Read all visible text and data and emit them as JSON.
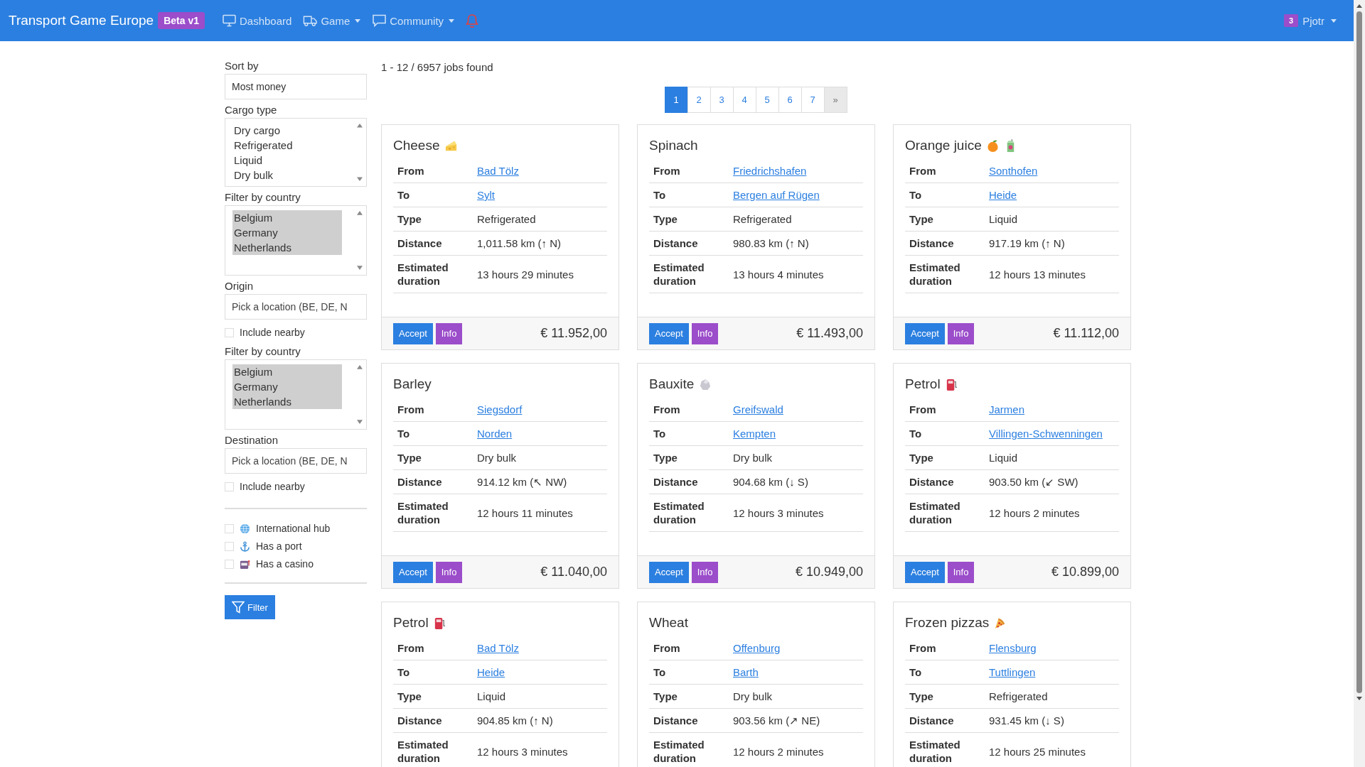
{
  "navbar": {
    "brand": "Transport Game Europe",
    "badge": "Beta v1",
    "items": [
      {
        "label": "Dashboard",
        "kind": "monitor",
        "dropdown": false
      },
      {
        "label": "Game",
        "kind": "truck",
        "dropdown": true
      },
      {
        "label": "Community",
        "kind": "chat",
        "dropdown": true
      }
    ],
    "user": {
      "count": "3",
      "name": "Pjotr"
    }
  },
  "sidebar": {
    "sort": {
      "label": "Sort by",
      "value": "Most money"
    },
    "cargo": {
      "label": "Cargo type",
      "options": [
        {
          "label": "Dry cargo",
          "selected": false
        },
        {
          "label": "Refrigerated",
          "selected": false
        },
        {
          "label": "Liquid",
          "selected": false
        },
        {
          "label": "Dry bulk",
          "selected": false
        }
      ]
    },
    "origin_countries": {
      "label": "Filter by country",
      "options": [
        {
          "label": "Belgium",
          "selected": true
        },
        {
          "label": "Germany",
          "selected": true
        },
        {
          "label": "Netherlands",
          "selected": true
        }
      ]
    },
    "origin": {
      "label": "Origin",
      "placeholder": "Pick a location (BE, DE, N",
      "include_nearby": {
        "label": "Include nearby",
        "checked": false
      }
    },
    "destination_countries": {
      "label": "Filter by country",
      "options": [
        {
          "label": "Belgium",
          "selected": true
        },
        {
          "label": "Germany",
          "selected": true
        },
        {
          "label": "Netherlands",
          "selected": true
        }
      ]
    },
    "destination": {
      "label": "Destination",
      "placeholder": "Pick a location (BE, DE, N",
      "include_nearby": {
        "label": "Include nearby",
        "checked": false
      }
    },
    "features": [
      {
        "label": "International hub",
        "kind": "globe",
        "checked": false
      },
      {
        "label": "Has a port",
        "kind": "anchor",
        "checked": false
      },
      {
        "label": "Has a casino",
        "kind": "slot",
        "checked": false
      }
    ],
    "filter_button": "Filter"
  },
  "results": {
    "summary": "1 - 12 / 6957 jobs found",
    "pages": [
      {
        "label": "1",
        "selected": true
      },
      {
        "label": "2",
        "selected": false
      },
      {
        "label": "3",
        "selected": false
      },
      {
        "label": "4",
        "selected": false
      },
      {
        "label": "5",
        "selected": false
      },
      {
        "label": "6",
        "selected": false
      },
      {
        "label": "7",
        "selected": false
      }
    ],
    "next": {
      "label": "»",
      "disabled": true
    },
    "jobs": [
      {
        "title": "Cheese",
        "icons": [
          {
            "kind": "cheese"
          }
        ],
        "rows": [
          {
            "label": "From",
            "value": "Bad Tölz",
            "kind": "link"
          },
          {
            "label": "To",
            "value": "Sylt",
            "kind": "link"
          },
          {
            "label": "Type",
            "value": "Refrigerated",
            "kind": "text"
          },
          {
            "label": "Distance",
            "value": "1,011.58 km (↑ N)",
            "kind": "text"
          },
          {
            "label": "Estimated duration",
            "value": "13 hours 29 minutes",
            "kind": "text"
          }
        ],
        "buttons": [
          "Accept",
          "Info"
        ],
        "price": "€ 11.952,00"
      },
      {
        "title": "Spinach",
        "rows": [
          {
            "label": "From",
            "value": "Friedrichshafen",
            "kind": "link"
          },
          {
            "label": "To",
            "value": "Bergen auf Rügen",
            "kind": "link"
          },
          {
            "label": "Type",
            "value": "Refrigerated",
            "kind": "text"
          },
          {
            "label": "Distance",
            "value": "980.83 km (↑ N)",
            "kind": "text"
          },
          {
            "label": "Estimated duration",
            "value": "13 hours 4 minutes",
            "kind": "text"
          }
        ],
        "buttons": [
          "Accept",
          "Info"
        ],
        "price": "€ 11.493,00"
      },
      {
        "title": "Orange juice",
        "icons": [
          {
            "kind": "orange"
          },
          {
            "kind": "juice"
          }
        ],
        "rows": [
          {
            "label": "From",
            "value": "Sonthofen",
            "kind": "link"
          },
          {
            "label": "To",
            "value": "Heide",
            "kind": "link"
          },
          {
            "label": "Type",
            "value": "Liquid",
            "kind": "text"
          },
          {
            "label": "Distance",
            "value": "917.19 km (↑ N)",
            "kind": "text"
          },
          {
            "label": "Estimated duration",
            "value": "12 hours 13 minutes",
            "kind": "text"
          }
        ],
        "buttons": [
          "Accept",
          "Info"
        ],
        "price": "€ 11.112,00"
      },
      {
        "title": "Barley",
        "rows": [
          {
            "label": "From",
            "value": "Siegsdorf",
            "kind": "link"
          },
          {
            "label": "To",
            "value": "Norden",
            "kind": "link"
          },
          {
            "label": "Type",
            "value": "Dry bulk",
            "kind": "text"
          },
          {
            "label": "Distance",
            "value": "914.12 km (↖ NW)",
            "kind": "text"
          },
          {
            "label": "Estimated duration",
            "value": "12 hours 11 minutes",
            "kind": "text"
          }
        ],
        "buttons": [
          "Accept",
          "Info"
        ],
        "price": "€ 11.040,00"
      },
      {
        "title": "Bauxite",
        "icons": [
          {
            "kind": "rock"
          }
        ],
        "rows": [
          {
            "label": "From",
            "value": "Greifswald",
            "kind": "link"
          },
          {
            "label": "To",
            "value": "Kempten",
            "kind": "link"
          },
          {
            "label": "Type",
            "value": "Dry bulk",
            "kind": "text"
          },
          {
            "label": "Distance",
            "value": "904.68 km (↓ S)",
            "kind": "text"
          },
          {
            "label": "Estimated duration",
            "value": "12 hours 3 minutes",
            "kind": "text"
          }
        ],
        "buttons": [
          "Accept",
          "Info"
        ],
        "price": "€ 10.949,00"
      },
      {
        "title": "Petrol",
        "icons": [
          {
            "kind": "fuel"
          }
        ],
        "rows": [
          {
            "label": "From",
            "value": "Jarmen",
            "kind": "link"
          },
          {
            "label": "To",
            "value": "Villingen-Schwenningen",
            "kind": "link"
          },
          {
            "label": "Type",
            "value": "Liquid",
            "kind": "text"
          },
          {
            "label": "Distance",
            "value": "903.50 km (↙ SW)",
            "kind": "text"
          },
          {
            "label": "Estimated duration",
            "value": "12 hours 2 minutes",
            "kind": "text"
          }
        ],
        "buttons": [
          "Accept",
          "Info"
        ],
        "price": "€ 10.899,00"
      },
      {
        "title": "Petrol",
        "icons": [
          {
            "kind": "fuel"
          }
        ],
        "rows": [
          {
            "label": "From",
            "value": "Bad Tölz",
            "kind": "link"
          },
          {
            "label": "To",
            "value": "Heide",
            "kind": "link"
          },
          {
            "label": "Type",
            "value": "Liquid",
            "kind": "text"
          },
          {
            "label": "Distance",
            "value": "904.85 km (↑ N)",
            "kind": "text"
          },
          {
            "label": "Estimated duration",
            "value": "12 hours 3 minutes",
            "kind": "text"
          }
        ]
      },
      {
        "title": "Wheat",
        "rows": [
          {
            "label": "From",
            "value": "Offenburg",
            "kind": "link"
          },
          {
            "label": "To",
            "value": "Barth",
            "kind": "link"
          },
          {
            "label": "Type",
            "value": "Dry bulk",
            "kind": "text"
          },
          {
            "label": "Distance",
            "value": "903.56 km (↗ NE)",
            "kind": "text"
          },
          {
            "label": "Estimated duration",
            "value": "12 hours 2 minutes",
            "kind": "text"
          }
        ]
      },
      {
        "title": "Frozen pizzas",
        "icons": [
          {
            "kind": "pizza"
          }
        ],
        "rows": [
          {
            "label": "From",
            "value": "Flensburg",
            "kind": "link"
          },
          {
            "label": "To",
            "value": "Tuttlingen",
            "kind": "link"
          },
          {
            "label": "Type",
            "value": "Refrigerated",
            "kind": "text"
          },
          {
            "label": "Distance",
            "value": "931.45 km (↓ S)",
            "kind": "text"
          },
          {
            "label": "Estimated duration",
            "value": "12 hours 25 minutes",
            "kind": "text"
          }
        ]
      }
    ]
  }
}
